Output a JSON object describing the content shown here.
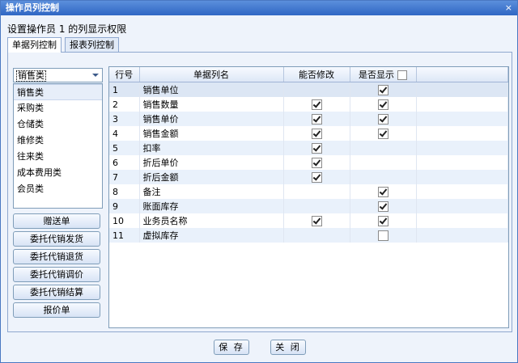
{
  "window": {
    "title": "操作员列控制",
    "close_glyph": "×"
  },
  "permission_label": "设置操作员 1 的列显示权限",
  "tabs": [
    {
      "label": "单据列控制",
      "active": true
    },
    {
      "label": "报表列控制",
      "active": false
    }
  ],
  "category": {
    "selected": "销售类",
    "options": [
      "销售类",
      "采购类",
      "仓储类",
      "维修类",
      "往来类",
      "成本费用类",
      "会员类"
    ]
  },
  "doc_buttons": [
    "赠送单",
    "委托代销发货",
    "委托代销退货",
    "委托代销调价",
    "委托代销结算",
    "报价单"
  ],
  "grid": {
    "headers": {
      "row_no": "行号",
      "column_name": "单据列名",
      "editable": "能否修改",
      "visible": "是否显示"
    },
    "header_visible_checked": false,
    "rows": [
      {
        "no": "1",
        "name": "销售单位",
        "editable": null,
        "visible": true
      },
      {
        "no": "2",
        "name": "销售数量",
        "editable": true,
        "visible": true
      },
      {
        "no": "3",
        "name": "销售单价",
        "editable": true,
        "visible": true
      },
      {
        "no": "4",
        "name": "销售金额",
        "editable": true,
        "visible": true
      },
      {
        "no": "5",
        "name": "扣率",
        "editable": true,
        "visible": null
      },
      {
        "no": "6",
        "name": "折后单价",
        "editable": true,
        "visible": null
      },
      {
        "no": "7",
        "name": "折后金额",
        "editable": true,
        "visible": null
      },
      {
        "no": "8",
        "name": "备注",
        "editable": null,
        "visible": true
      },
      {
        "no": "9",
        "name": "账面库存",
        "editable": null,
        "visible": true
      },
      {
        "no": "10",
        "name": "业务员名称",
        "editable": true,
        "visible": true
      },
      {
        "no": "11",
        "name": "虚拟库存",
        "editable": null,
        "visible": false
      }
    ]
  },
  "footer": {
    "save_label": "保 存",
    "close_label": "关 闭"
  }
}
